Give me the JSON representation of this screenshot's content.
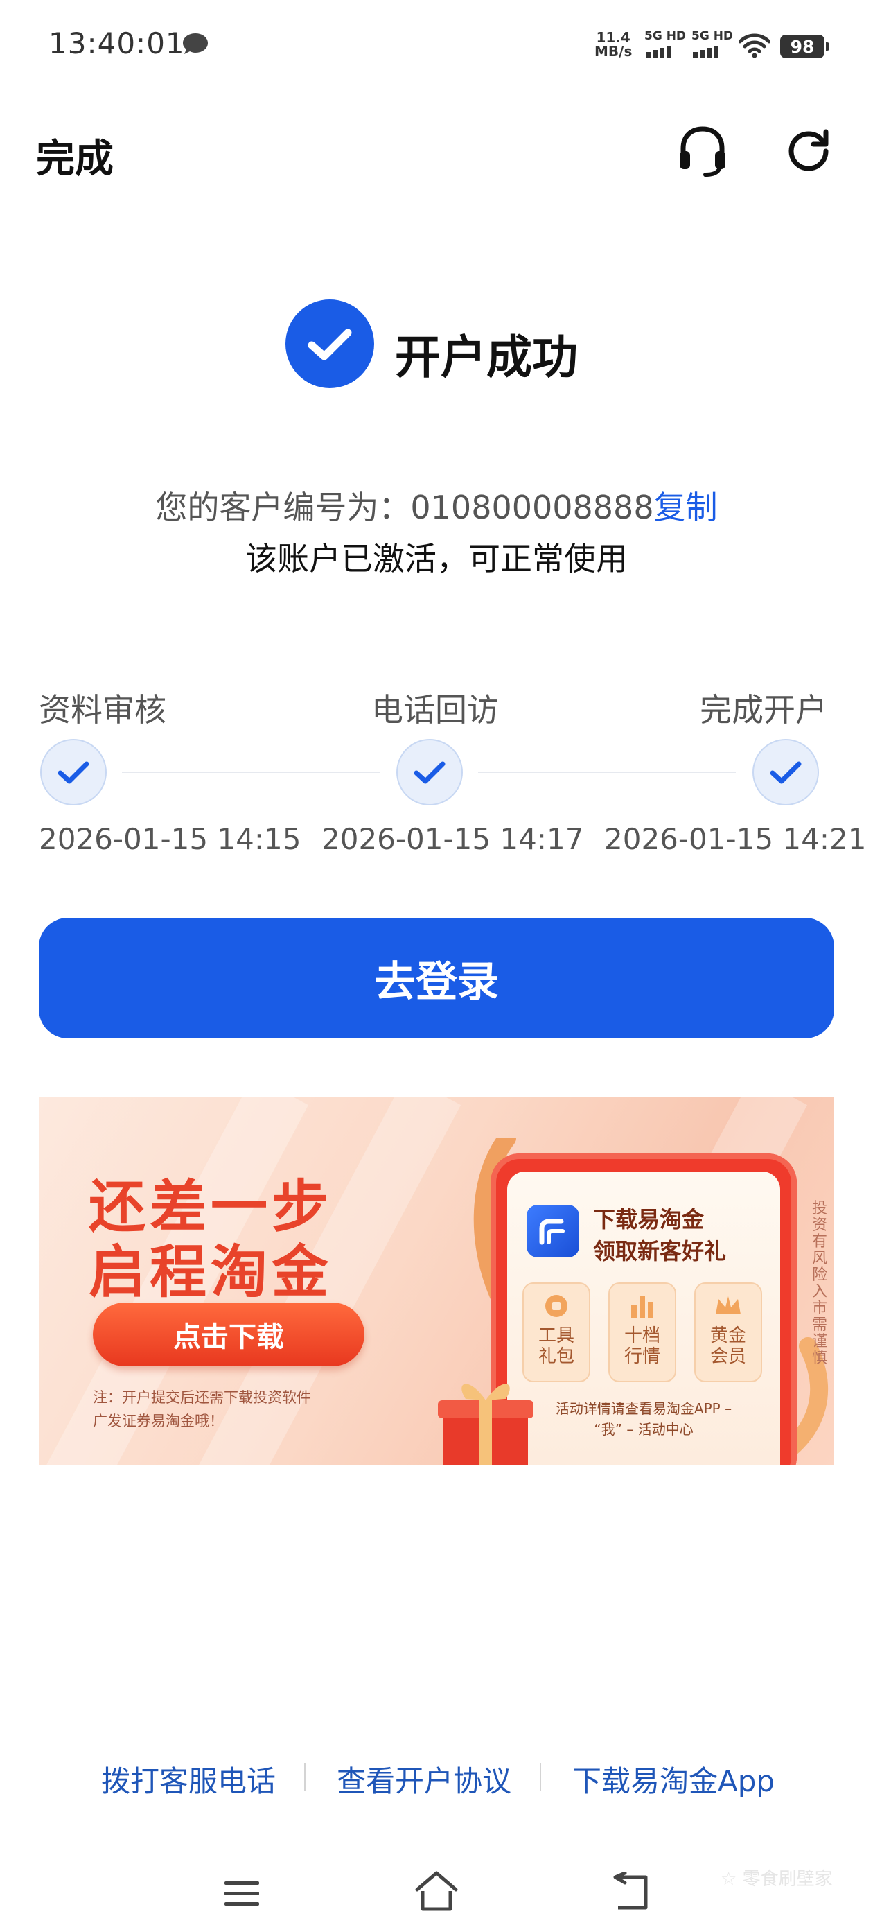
{
  "status_bar": {
    "time": "13:40:01",
    "net_speed_value": "11.4",
    "net_speed_unit": "MB/s",
    "signal1_label": "5G HD",
    "signal2_label": "5G HD",
    "battery": "98"
  },
  "header": {
    "done_label": "完成",
    "icons": [
      "headset-icon",
      "refresh-icon"
    ]
  },
  "success": {
    "title": "开户成功",
    "customer_prefix": "您的客户编号为：",
    "customer_number": "010800008888",
    "copy_label": "复制",
    "activated_text": "该账户已激活，可正常使用"
  },
  "steps": [
    {
      "label": "资料审核",
      "date": "2026-01-15 14:15"
    },
    {
      "label": "电话回访",
      "date": "2026-01-15 14:17"
    },
    {
      "label": "完成开户",
      "date": "2026-01-15 14:21"
    }
  ],
  "login_label": "去登录",
  "banner": {
    "line1": "还差一步",
    "line2": "启程淘金",
    "button": "点击下载",
    "note1": "注：开户提交后还需下载投资软件",
    "note2": "广发证券易淘金哦！",
    "card_title1": "下载易淘金",
    "card_title2": "领取新客好礼",
    "perks": [
      {
        "line1": "工具",
        "line2": "礼包"
      },
      {
        "line1": "十档",
        "line2": "行情"
      },
      {
        "line1": "黄金",
        "line2": "会员"
      }
    ],
    "card_foot1": "活动详情请查看易淘金APP –",
    "card_foot2": "“我” – 活动中心",
    "risk_text": "投资有风险 入市需谨慎",
    "colors": {
      "title": "#e8432a",
      "button": "#e8381f",
      "phone": "#ef3b2c"
    }
  },
  "footer": {
    "call_label": "拨打客服电话",
    "agreement_label": "查看开户协议",
    "download_label": "下载易淘金App"
  },
  "watermark": "☆ 零食刷壁家",
  "colors": {
    "accent": "#1a5ce6",
    "link": "#1f56b8"
  }
}
